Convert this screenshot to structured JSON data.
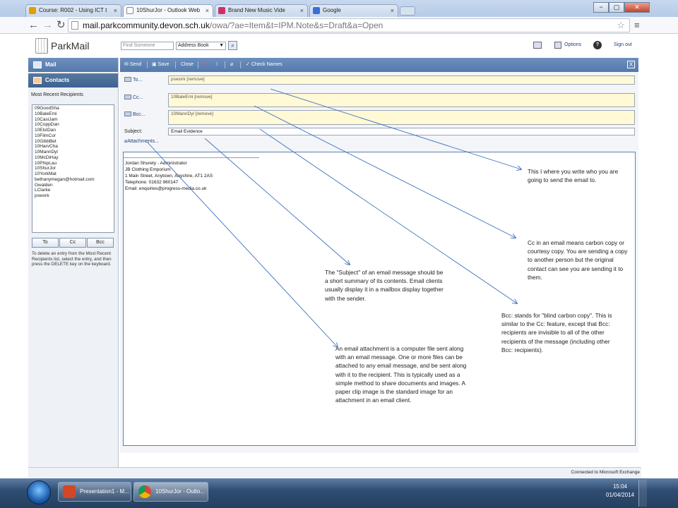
{
  "browser": {
    "tabs": [
      {
        "label": "Course: R002 - Using ICT t",
        "close": "×"
      },
      {
        "label": "10ShurJor - Outlook Web",
        "close": "×"
      },
      {
        "label": "Brand New Music Vide",
        "close": "×"
      },
      {
        "label": "Google",
        "close": "×"
      }
    ],
    "window_buttons": [
      "−",
      "▢",
      "✕"
    ],
    "url_host": "mail.parkcommunity.devon.sch.uk",
    "url_path": "/owa/?ae=Item&t=IPM.Note&s=Draft&a=Open"
  },
  "header": {
    "logo": "ParkMail",
    "find_placeholder": "Find Someone",
    "address_book": "Address Book",
    "options": "Options",
    "help": "?",
    "sign_out": "Sign out"
  },
  "sidebar": {
    "mail": "Mail",
    "contacts": "Contacts",
    "recent_title": "Most Recent Recipients",
    "recipients": [
      "09GoodSha",
      "10BaleEmi",
      "10CasiJam",
      "10CoppDan",
      "10ElstDan",
      "10FilmCor",
      "10GibbBet",
      "10HarvCha",
      "10MannDyl",
      "10McDiHay",
      "10PhipLau",
      "10ShurJor",
      "10YorkMat",
      "bethanymegan@hotmail.com",
      "Gwalden",
      "LClarke",
      "pswork"
    ],
    "to_btn": "To",
    "cc_btn": "Cc",
    "bcc_btn": "Bcc",
    "help_text": "To delete an entry from the Most Recent Recipients list, select the entry, and then press the DELETE key on the keyboard."
  },
  "toolbar": {
    "send": "Send",
    "save": "Save",
    "close": "Close",
    "check_names": "Check Names",
    "close_x": "X"
  },
  "compose": {
    "to_label": "To...",
    "to_value": "pswork [remove]",
    "cc_label": "Cc...",
    "cc_value": "10BaleEmi [remove]",
    "bcc_label": "Bcc...",
    "bcc_value": "10MannDyl [remove]",
    "subject_label": "Subject:",
    "subject_value": "Email Evidence",
    "attachments_label": "Attachments..."
  },
  "signature": {
    "rule": "--------------------------------------------------------------------------------------------------------------------------------",
    "lines": [
      "Jordan Shurety - Administrator",
      "JB Clothing Emporium",
      "1 Main Street, Anytown, Anyshire, AT1 2AS",
      "Telephone: 01632 960147",
      "Email: enquiries@progress-media.co.uk"
    ]
  },
  "status": "Connected to Microsoft Exchange",
  "annotations": {
    "to": "This I where you write who you are going to send the email to.",
    "cc": "Cc in an email means carbon copy or courtesy copy.  You are sending a copy to another person but the original contact can see you are sending it to them.",
    "subject": "The \"Subject\" of an email message should be a short summary of its contents. Email clients usually display it in a mailbox display together with the sender.",
    "bcc": "Bcc: stands for \"blind carbon copy\". This is similar to the Cc: feature, except that Bcc: recipients are invisible to all of the other recipients of the message (including other Bcc: recipients).",
    "attachment": "An email attachment is a computer file sent along with an email message. One or more files can be attached to any email message, and be sent along with it to the recipient. This is typically used as a simple method to share documents and images. A paper clip image is the standard image for an attachment in an email client."
  },
  "taskbar": {
    "task1": "Presentation1 - M...",
    "task2": "10ShurJor - Outlo...",
    "time": "15:04",
    "date": "01/04/2014"
  },
  "colors": {
    "toolbar_blue": "#5479ab",
    "arrow": "#3e6fbf",
    "field_yellow": "#fff9d6"
  }
}
